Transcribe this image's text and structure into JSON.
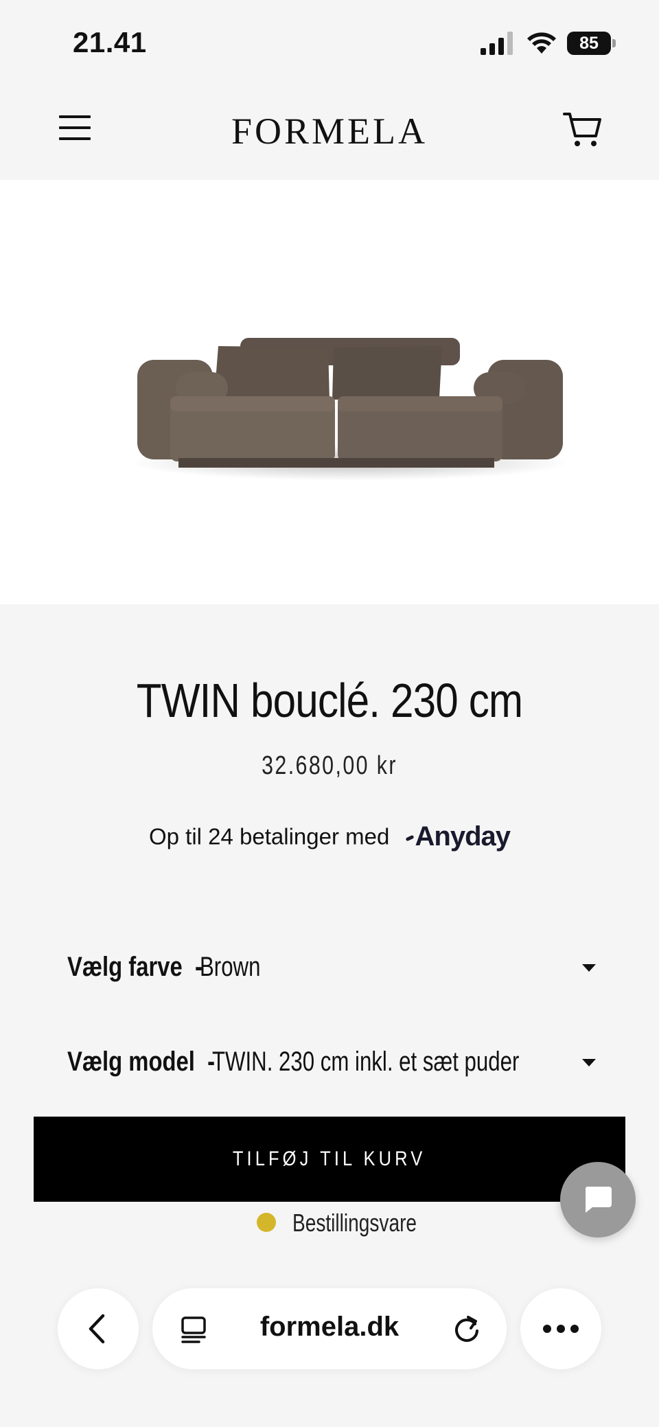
{
  "status_bar": {
    "time": "21.41",
    "battery": "85",
    "icons": [
      "signal-icon",
      "wifi-icon",
      "battery-icon"
    ]
  },
  "header": {
    "logo": "FORMELA",
    "icons": [
      "menu-icon",
      "cart-icon"
    ]
  },
  "product": {
    "title": "TWIN bouclé. 230 cm",
    "price": "32.680,00 kr",
    "installments_text": "Op til 24 betalinger med",
    "installments_provider": "Anyday",
    "sofa_color": "#6b5e53"
  },
  "options": {
    "color": {
      "label": "Vælg farve",
      "separator": "-",
      "value": "Brown"
    },
    "model": {
      "label": "Vælg model",
      "separator": "-",
      "value": "TWIN. 230 cm inkl. et sæt puder"
    }
  },
  "actions": {
    "add_to_cart": "TILFØJ TIL KURV"
  },
  "stock": {
    "status": "Bestillingsvare",
    "dot_color": "#d4b62a"
  },
  "browser": {
    "url": "formela.dk",
    "icons": [
      "back-icon",
      "reader-icon",
      "reload-icon",
      "more-icon"
    ]
  }
}
